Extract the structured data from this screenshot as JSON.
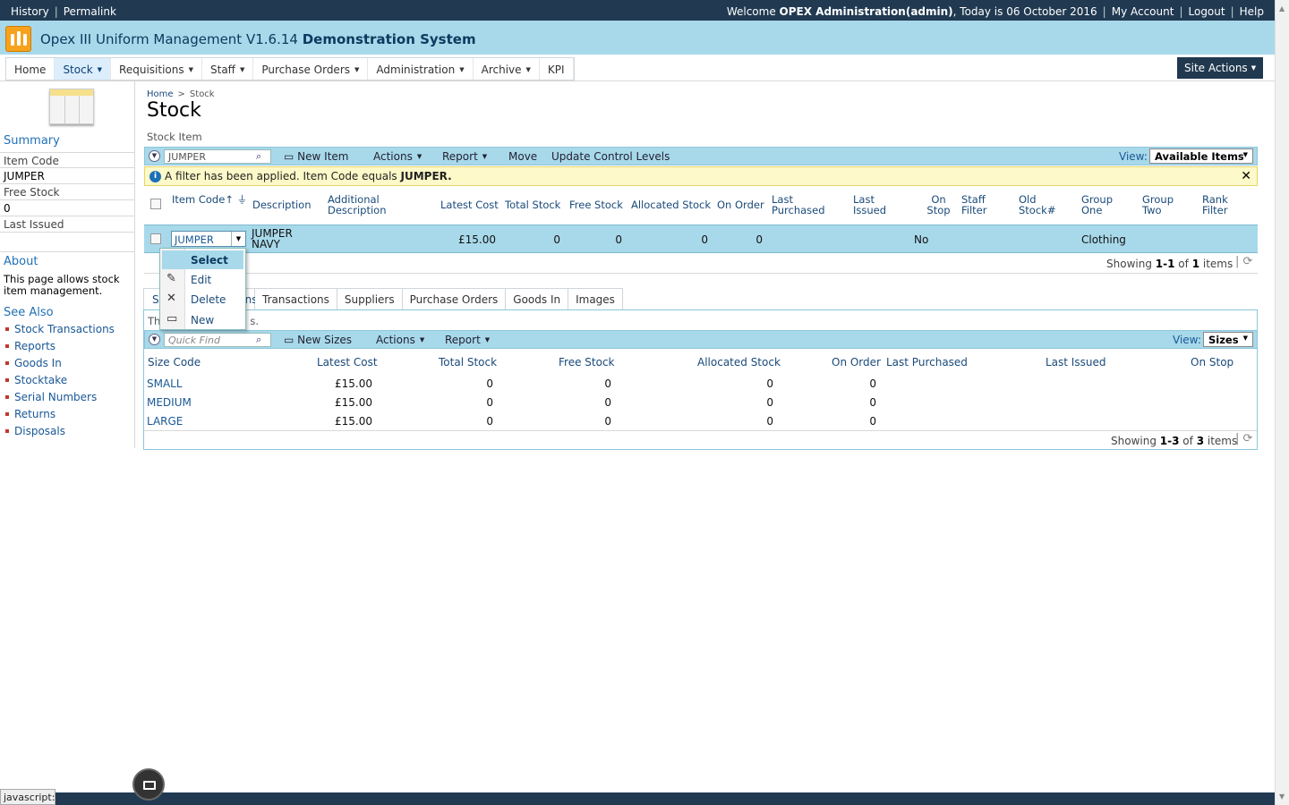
{
  "topbar": {
    "history": "History",
    "permalink": "Permalink",
    "welcome_prefix": "Welcome",
    "user": "OPEX Administration(admin)",
    "today": ", Today is 06 October 2016",
    "my_account": "My Account",
    "logout": "Logout",
    "help": "Help"
  },
  "app": {
    "title": "Opex III Uniform Management V1.6.14",
    "subtitle": "Demonstration System"
  },
  "nav": {
    "items": [
      {
        "label": "Home"
      },
      {
        "label": "Stock"
      },
      {
        "label": "Requisitions"
      },
      {
        "label": "Staff"
      },
      {
        "label": "Purchase Orders"
      },
      {
        "label": "Administration"
      },
      {
        "label": "Archive"
      },
      {
        "label": "KPI"
      }
    ],
    "site_actions": "Site Actions"
  },
  "left": {
    "summary_heading": "Summary",
    "item_code_label": "Item Code",
    "item_code_value": "JUMPER",
    "free_stock_label": "Free Stock",
    "free_stock_value": "0",
    "last_issued_label": "Last Issued",
    "about_heading": "About",
    "about_text": "This page allows stock item management.",
    "see_also_heading": "See Also",
    "see_also": [
      "Stock Transactions",
      "Reports",
      "Goods In",
      "Stocktake",
      "Serial Numbers",
      "Returns",
      "Disposals"
    ]
  },
  "page": {
    "breadcrumb_home": "Home",
    "breadcrumb_sep": ">",
    "breadcrumb_current": "Stock",
    "title": "Stock",
    "section_label": "Stock Item"
  },
  "toolbar1": {
    "search_value": "JUMPER",
    "new_item": "New Item",
    "actions": "Actions",
    "report": "Report",
    "move": "Move",
    "update_levels": "Update Control Levels",
    "view_label": "View:",
    "view_value": "Available Items"
  },
  "filter": {
    "text": "A filter has been applied. Item Code equals",
    "value": "JUMPER."
  },
  "grid": {
    "headers": [
      "Item Code",
      "Description",
      "Additional Description",
      "Latest Cost",
      "Total Stock",
      "Free Stock",
      "Allocated Stock",
      "On Order",
      "Last Purchased",
      "Last Issued",
      "On Stop",
      "Staff Filter",
      "Old Stock#",
      "Group One",
      "Group Two",
      "Rank Filter"
    ],
    "row": {
      "code": "JUMPER",
      "description": "JUMPER NAVY",
      "latest_cost": "£15.00",
      "total_stock": "0",
      "free_stock": "0",
      "allocated_stock": "0",
      "on_order": "0",
      "on_stop": "No",
      "group_one": "Clothing"
    },
    "showing": "Showing",
    "range": "1-1",
    "of": "of",
    "count": "1",
    "items": "items"
  },
  "context_menu": {
    "select": "Select",
    "edit": "Edit",
    "delete": "Delete",
    "new": "New"
  },
  "tabs": [
    "S",
    "ns",
    "Transactions",
    "Suppliers",
    "Purchase Orders",
    "Goods In",
    "Images"
  ],
  "panel_hint_a": "Th",
  "panel_hint_b": "s.",
  "toolbar2": {
    "quick_find": "Quick Find",
    "new_sizes": "New Sizes",
    "actions": "Actions",
    "report": "Report",
    "view_label": "View:",
    "view_value": "Sizes"
  },
  "sizes": {
    "headers": [
      "Size Code",
      "Latest Cost",
      "Total Stock",
      "Free Stock",
      "Allocated Stock",
      "On Order",
      "Last Purchased",
      "Last Issued",
      "On Stop"
    ],
    "rows": [
      {
        "code": "SMALL",
        "cost": "£15.00",
        "total": "0",
        "free": "0",
        "allocated": "0",
        "on_order": "0"
      },
      {
        "code": "MEDIUM",
        "cost": "£15.00",
        "total": "0",
        "free": "0",
        "allocated": "0",
        "on_order": "0"
      },
      {
        "code": "LARGE",
        "cost": "£15.00",
        "total": "0",
        "free": "0",
        "allocated": "0",
        "on_order": "0"
      }
    ],
    "showing": "Showing",
    "range": "1-3",
    "of": "of",
    "count": "3",
    "items": "items"
  },
  "statusbar": "javascript:"
}
